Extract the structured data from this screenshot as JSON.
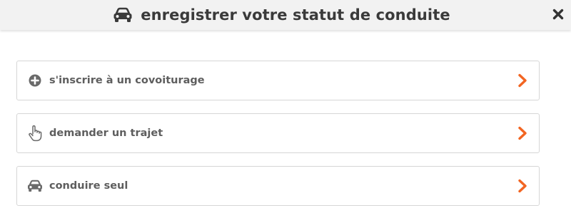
{
  "header": {
    "title": "enregistrer votre statut de conduite",
    "icon": "car-icon",
    "close_icon": "close-icon"
  },
  "options": [
    {
      "label": "s'inscrire à un covoiturage",
      "icon": "plus-circle-icon"
    },
    {
      "label": "demander un trajet",
      "icon": "hand-pointer-icon"
    },
    {
      "label": "conduire seul",
      "icon": "car-icon"
    }
  ],
  "colors": {
    "accent": "#f26522",
    "text": "#5e5e5e",
    "title": "#3a3a3a",
    "header_bg": "#f2f2f2",
    "border": "#d6d6d6"
  }
}
